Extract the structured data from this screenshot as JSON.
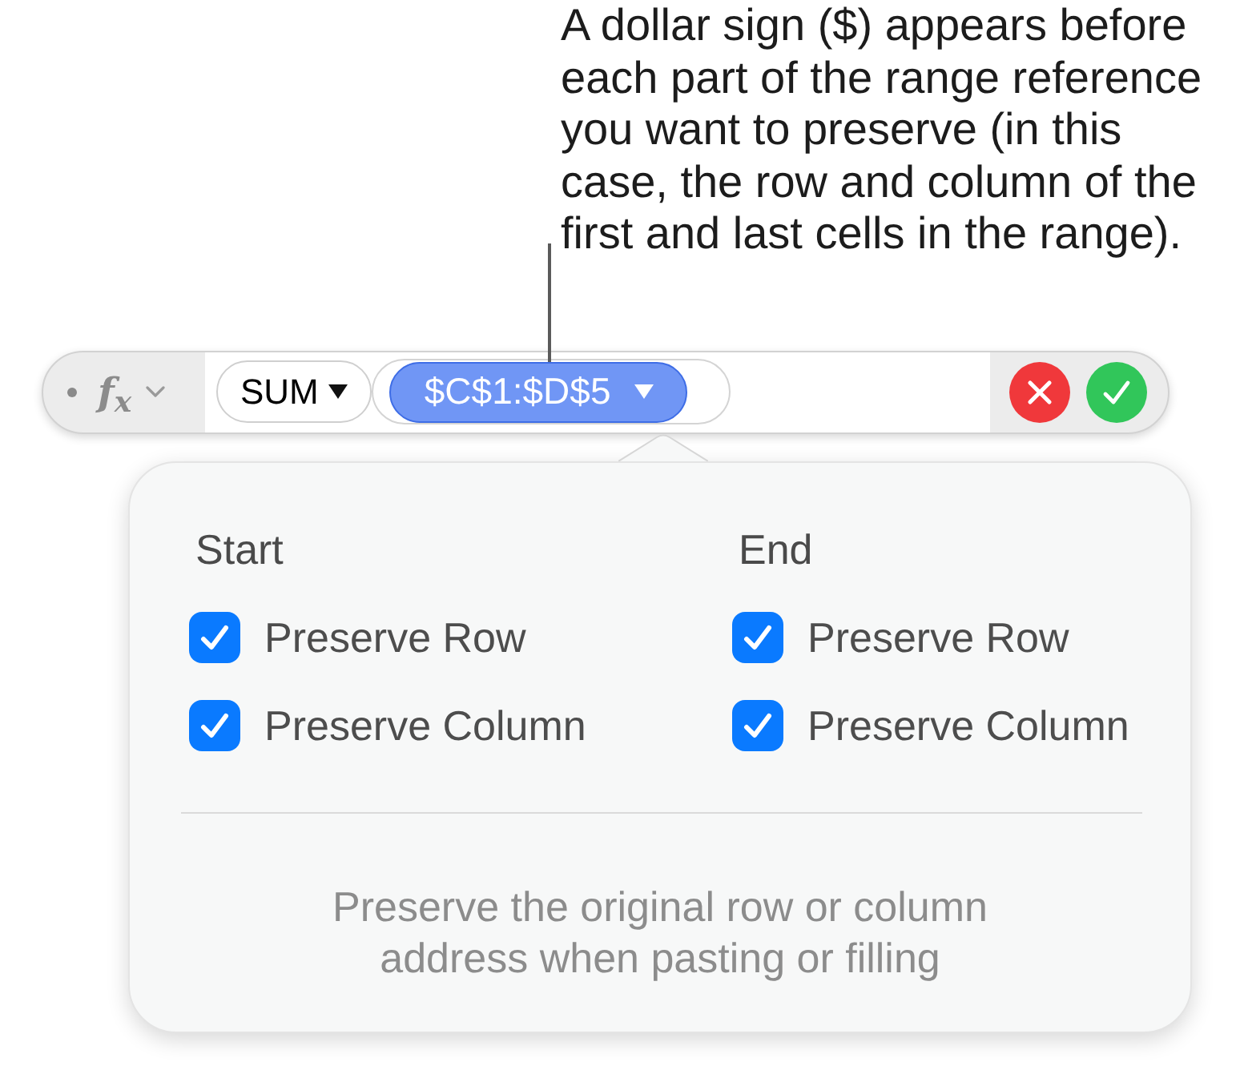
{
  "callout": {
    "text": "A dollar sign ($) appears before\neach part of the range reference\nyou want to preserve (in this\ncase, the row and column of the\nfirst and last cells in the range)."
  },
  "formula_bar": {
    "function_menu_label": "f$_{x}$",
    "function": {
      "name": "SUM"
    },
    "argument": {
      "text": "$C$1:$D$5",
      "selected": true
    }
  },
  "popover": {
    "columns": [
      {
        "heading": "Start",
        "options": [
          {
            "label": "Preserve Row",
            "checked": true
          },
          {
            "label": "Preserve Column",
            "checked": true
          }
        ]
      },
      {
        "heading": "End",
        "options": [
          {
            "label": "Preserve Row",
            "checked": true
          },
          {
            "label": "Preserve Column",
            "checked": true
          }
        ]
      }
    ],
    "footer": "Preserve the original row or column\naddress when pasting or filling"
  }
}
